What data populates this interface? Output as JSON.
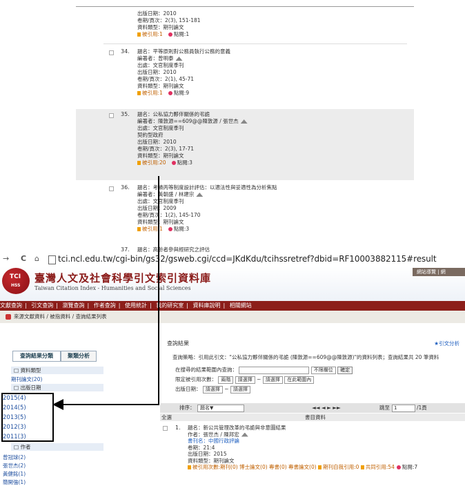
{
  "top_records": {
    "partial": {
      "lines": [
        "出版日期：2010",
        "卷期/頁次：2(3), 151-181",
        "資料類型：期刊論文"
      ],
      "cited": "被引用:1",
      "clicks": "點閱:1"
    },
    "items": [
      {
        "num": "34.",
        "title": "題名：平等原則對公務員執行公務的意義",
        "author": "編著者：曾明泰",
        "source": "出處：文官制度季刊",
        "source2": "",
        "date": "出版日期：2010",
        "vol": "卷期/頁次：2(1), 45-71",
        "type": "資料類型：期刊論文",
        "cited": "被引用:1",
        "clicks": "點閱:9"
      },
      {
        "num": "35.",
        "title": "題名：公私協力夥伴關係的弔詭",
        "author": "編著者：陳敦源==609@@陳敦源 / 張世杰",
        "source": "出處：文官制度季刊",
        "source2": "    契約型政府",
        "date": "出版日期：2010",
        "vol": "卷期/頁次：2(3), 17-71",
        "type": "資料類型：期刊論文",
        "cited": "被引用:20",
        "clicks": "點閱:3"
      },
      {
        "num": "36.",
        "title": "題名：考績丙等制度設計評估：以適法性與妥適性為分析焦點",
        "author": "編著者：黃朝盛 / 林建宗",
        "source": "出處：文官制度季刊",
        "source2": "",
        "date": "出版日期：2009",
        "vol": "卷期/頁次：1(2), 145-170",
        "type": "資料類型：期刊論文",
        "cited": "被引用:1",
        "clicks": "點閱:3"
      }
    ],
    "last_num": "37.",
    "last_title": "題名：高齡者參與經研究之評估"
  },
  "browser": {
    "back": "→",
    "reload": "C",
    "home": "⌂",
    "url": "tci.ncl.edu.tw/cgi-bin/gs32/gsweb.cgi/ccd=JKdKdu/tcihssretref?dbid=RF10003882115#result"
  },
  "site": {
    "logo_top": "TCI",
    "logo_bottom": "HSS",
    "title": "臺灣人文及社會科學引文索引資料庫",
    "subtitle": "Taiwan Citation Index - Humanities and Social Sciences",
    "top_links": "網站導覽 | 網",
    "nav": [
      "文獻查詢",
      "|",
      "引文查詢",
      "|",
      "瀏覽查詢",
      "|",
      "作者查詢",
      "|",
      "使用統計",
      "|",
      "我的研究室",
      "|",
      "資料庫說明",
      "|",
      "相關網站"
    ],
    "breadcrumb": "來源文獻資料 / 被指資料 / 查詢結果列表"
  },
  "sidebar": {
    "tab_active": "查詢結果分類",
    "tab_other": "聚類分析",
    "type_head": "□ 資料類型",
    "type_items": [
      "期刊論文(20)"
    ],
    "date_head": "□ 出版日期",
    "date_items": [
      "2015(4)",
      "2014(5)",
      "2013(5)",
      "2012(3)",
      "2011(3)"
    ],
    "author_head": "□ 作者",
    "author_items": [
      "曾冠球(2)",
      "張世杰(2)",
      "黃健銘(1)",
      "簡開強(1)"
    ]
  },
  "main": {
    "title": "查詢結果",
    "more": "★引文分析",
    "strategy": "查詢策略：引用此引文：\"公私協力夥伴關係的弔詭 (陳敦源==609@@陳敦源)\"的資料列表；查詢結果共 20 筆資料",
    "row1_label": "在搜尋的結果範圍內查詢：",
    "row1_sel": "不限欄位",
    "row1_btn": "確定",
    "row2_label": "限定被引用次數：",
    "row2_sel1": "兩階",
    "row2_sel2": "請選擇",
    "row2_sep": "~",
    "row2_sel3": "請選擇",
    "row2_sel4": "在此範圍內",
    "row3_label": "出版日期：",
    "row3_sel1": "請選擇",
    "row3_sep": "~",
    "row3_sel2": "請選擇",
    "sort_label": "排序：",
    "sort_sel": "題名▼",
    "pager": "◄◄ ◄ ► ►►",
    "goto_label": "跳至",
    "goto_value": "1",
    "goto_total": "/1頁",
    "col_all": "全選",
    "col_data": "書目資料",
    "result": {
      "num": "1.",
      "title": "題名：新公共管理改革的弔詭與非意圖結果",
      "author": "作者：張世杰 / 陳邦宏",
      "journal": "書刊名：中國行政評論",
      "vol": "卷期：21:4",
      "date": "出版日期：2015",
      "type": "資料類型：期刊論文",
      "stats": "被引用次數:期刊(0) 博士論文(0) 專書(0) 專書論文(0)",
      "self": "期刊自我引用:0",
      "common": "共同引用:54",
      "clicks": "點閱:7"
    }
  }
}
